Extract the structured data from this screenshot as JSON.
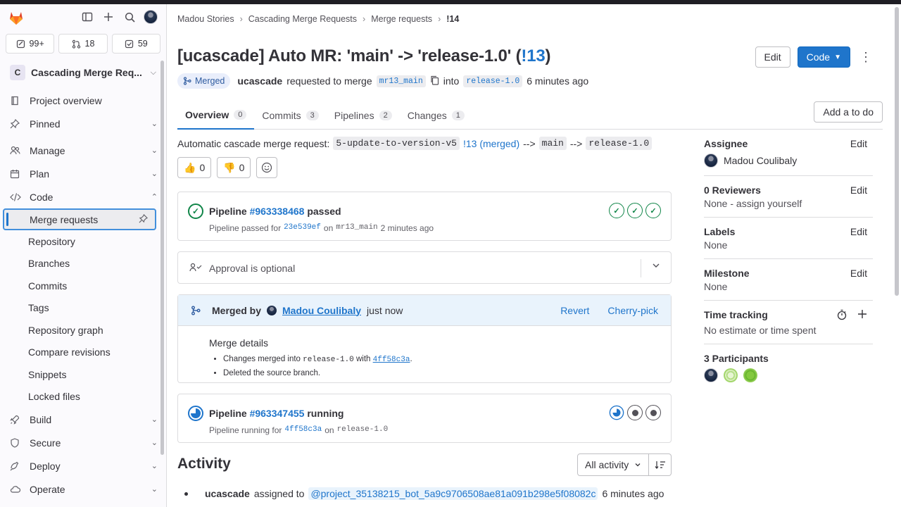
{
  "sidebar": {
    "counters": [
      {
        "icon": "issues-icon",
        "value": "99+"
      },
      {
        "icon": "merge-request-icon",
        "value": "18"
      },
      {
        "icon": "todo-icon",
        "value": "59"
      }
    ],
    "project": {
      "badge": "C",
      "name": "Cascading Merge Req..."
    },
    "nav": {
      "project_overview": "Project overview",
      "pinned": "Pinned",
      "manage": "Manage",
      "plan": "Plan",
      "code": "Code",
      "code_items": [
        "Merge requests",
        "Repository",
        "Branches",
        "Commits",
        "Tags",
        "Repository graph",
        "Compare revisions",
        "Snippets",
        "Locked files"
      ],
      "build": "Build",
      "secure": "Secure",
      "deploy": "Deploy",
      "operate": "Operate"
    }
  },
  "breadcrumb": [
    "Madou Stories",
    "Cascading Merge Requests",
    "Merge requests",
    "!14"
  ],
  "mr": {
    "title_prefix": "[ucascade] Auto MR: 'main' -> 'release-1.0' (",
    "title_link": "!13",
    "title_suffix": ")",
    "status": "Merged",
    "author": "ucascade",
    "requested": "requested to merge",
    "source_branch": "mr13_main",
    "into": "into",
    "target_branch": "release-1.0",
    "time": "6 minutes ago"
  },
  "header_buttons": {
    "edit": "Edit",
    "code": "Code"
  },
  "tabs": [
    {
      "label": "Overview",
      "count": "0"
    },
    {
      "label": "Commits",
      "count": "3"
    },
    {
      "label": "Pipelines",
      "count": "2"
    },
    {
      "label": "Changes",
      "count": "1"
    }
  ],
  "todo_button": "Add a to do",
  "description": {
    "prefix": "Automatic cascade merge request:",
    "b1": "5-update-to-version-v5",
    "link": "!13 (merged)",
    "arrow1": "-->",
    "b2": "main",
    "arrow2": "-->",
    "b3": "release-1.0"
  },
  "reactions": {
    "thumbs_up": "0",
    "thumbs_down": "0"
  },
  "pipeline1": {
    "label": "Pipeline",
    "id": "#963338468",
    "status": "passed",
    "sub_prefix": "Pipeline passed for",
    "commit": "23e539ef",
    "on": "on",
    "branch": "mr13_main",
    "time": "2 minutes ago"
  },
  "approval": "Approval is optional",
  "merged": {
    "by": "Merged by",
    "user": "Madou Coulibaly",
    "when": "just now",
    "revert": "Revert",
    "cherry": "Cherry-pick",
    "details_title": "Merge details",
    "d1_prefix": "Changes merged into",
    "d1_branch": "release-1.0",
    "d1_with": "with",
    "d1_commit": "4ff58c3a",
    "d1_dot": ".",
    "d2": "Deleted the source branch."
  },
  "pipeline2": {
    "label": "Pipeline",
    "id": "#963347455",
    "status": "running",
    "sub_prefix": "Pipeline running for",
    "commit": "4ff58c3a",
    "on": "on",
    "branch": "release-1.0"
  },
  "right": {
    "assignee_h": "Assignee",
    "assignee": "Madou Coulibaly",
    "reviewers_h": "0 Reviewers",
    "reviewers": "None - assign yourself",
    "labels_h": "Labels",
    "labels": "None",
    "milestone_h": "Milestone",
    "milestone": "None",
    "time_h": "Time tracking",
    "time": "No estimate or time spent",
    "participants_h": "3 Participants",
    "edit": "Edit"
  },
  "activity": {
    "title": "Activity",
    "filter": "All activity",
    "user": "ucascade",
    "action": "assigned to",
    "mention": "@project_35138215_bot_5a9c9706508ae81a091b298e5f08082c",
    "time": "6 minutes ago"
  },
  "colors": {
    "accent": "#1f75cb",
    "success": "#108548",
    "merged_bg": "#e9eefb"
  }
}
